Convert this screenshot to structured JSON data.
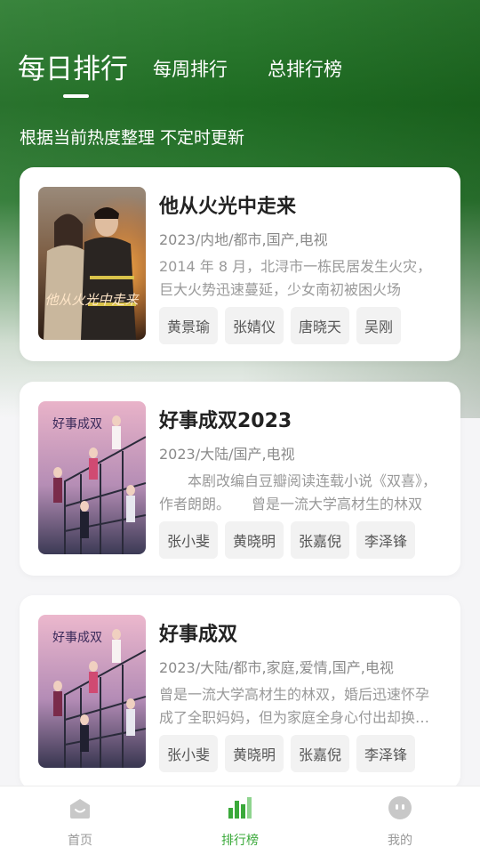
{
  "colors": {
    "header_green": "#1e6b22",
    "accent_green": "#3aa93a",
    "nav_inactive": "#999999",
    "card_bg": "#ffffff",
    "tag_bg": "#f2f2f2"
  },
  "tabs": [
    {
      "label": "每日排行",
      "active": true
    },
    {
      "label": "每周排行",
      "active": false
    },
    {
      "label": "总排行榜",
      "active": false
    }
  ],
  "subtitle": "根据当前热度整理 不定时更新",
  "items": [
    {
      "title": "他从火光中走来",
      "meta": "2023/内地/都市,国产,电视",
      "description": "2014 年 8 月，北浔市一栋民居发生火灾，巨大火势迅速蔓延，少女南初被困火场",
      "poster_text": "他从火光中走来",
      "poster_icon": "firefighter-poster",
      "tags": [
        "黄景瑜",
        "张婧仪",
        "唐晓天",
        "吴刚"
      ]
    },
    {
      "title": "好事成双2023",
      "meta": "2023/大陆/国产,电视",
      "description": "　　本剧改编自豆瓣阅读连载小说《双喜》，作者朗朗。　　曾是一流大学高材生的林双",
      "poster_text": "好事成双",
      "poster_icon": "family-staircase-poster",
      "tags": [
        "张小斐",
        "黄晓明",
        "张嘉倪",
        "李泽锋"
      ]
    },
    {
      "title": "好事成双",
      "meta": "2023/大陆/都市,家庭,爱情,国产,电视",
      "description": "曾是一流大学高材生的林双，婚后迅速怀孕成了全职妈妈，但为家庭全身心付出却换来背叛",
      "poster_text": "好事成双",
      "poster_icon": "family-staircase-poster",
      "tags": [
        "张小斐",
        "黄晓明",
        "张嘉倪",
        "李泽锋"
      ]
    }
  ],
  "bottom_nav": [
    {
      "label": "首页",
      "icon": "home-icon",
      "active": false
    },
    {
      "label": "排行榜",
      "icon": "ranking-bars-icon",
      "active": true
    },
    {
      "label": "我的",
      "icon": "profile-face-icon",
      "active": false
    }
  ]
}
